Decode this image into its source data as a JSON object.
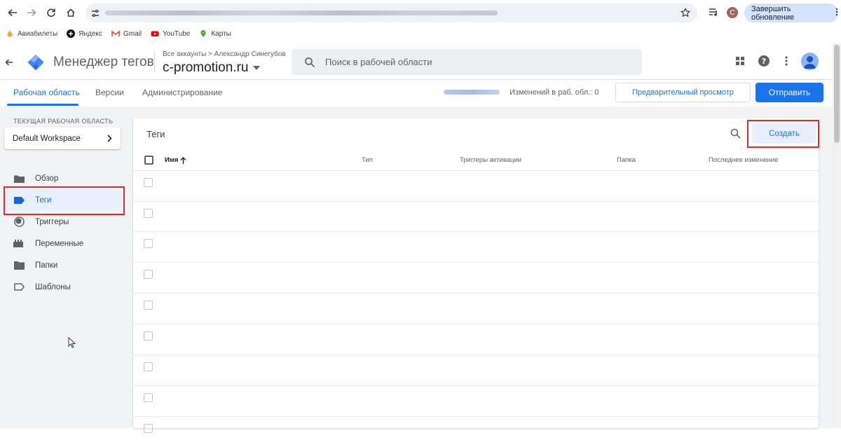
{
  "browser": {
    "update_button": "Завершить обновление",
    "profile_initial": "С"
  },
  "bookmarks": [
    {
      "label": "Авиабилеты",
      "icon": "flame-icon"
    },
    {
      "label": "Яндекс",
      "icon": "plus-circle-icon"
    },
    {
      "label": "Gmail",
      "icon": "gmail-icon"
    },
    {
      "label": "YouTube",
      "icon": "youtube-icon"
    },
    {
      "label": "Карты",
      "icon": "maps-icon"
    }
  ],
  "header": {
    "product_name": "Менеджер тегов",
    "breadcrumb": "Все аккаунты > Александр Синегубов",
    "container_name": "c-promotion.ru",
    "search_placeholder": "Поиск в рабочей области"
  },
  "tabs": {
    "workspace": "Рабочая область",
    "versions": "Версии",
    "admin": "Администрирование",
    "changes_label": "Изменений в раб. обл.: 0",
    "preview_button": "Предварительный просмотр",
    "submit_button": "Отправить"
  },
  "sidebar": {
    "workspace_label": "ТЕКУЩАЯ РАБОЧАЯ ОБЛАСТЬ",
    "workspace_name": "Default Workspace",
    "items": [
      {
        "label": "Обзор",
        "icon": "folder-icon"
      },
      {
        "label": "Теги",
        "icon": "tag-icon",
        "active": true
      },
      {
        "label": "Триггеры",
        "icon": "trigger-icon"
      },
      {
        "label": "Переменные",
        "icon": "variables-icon"
      },
      {
        "label": "Папки",
        "icon": "folder-icon"
      },
      {
        "label": "Шаблоны",
        "icon": "template-icon"
      }
    ]
  },
  "main": {
    "title": "Теги",
    "create_button": "Создать",
    "columns": [
      "Имя",
      "Тип",
      "Триггеры активации",
      "Папка",
      "Последнее изменение"
    ]
  },
  "colors": {
    "accent": "#1a73e8",
    "highlight": "#e02b2b",
    "sidebar_bg": "#f1f3f4"
  }
}
